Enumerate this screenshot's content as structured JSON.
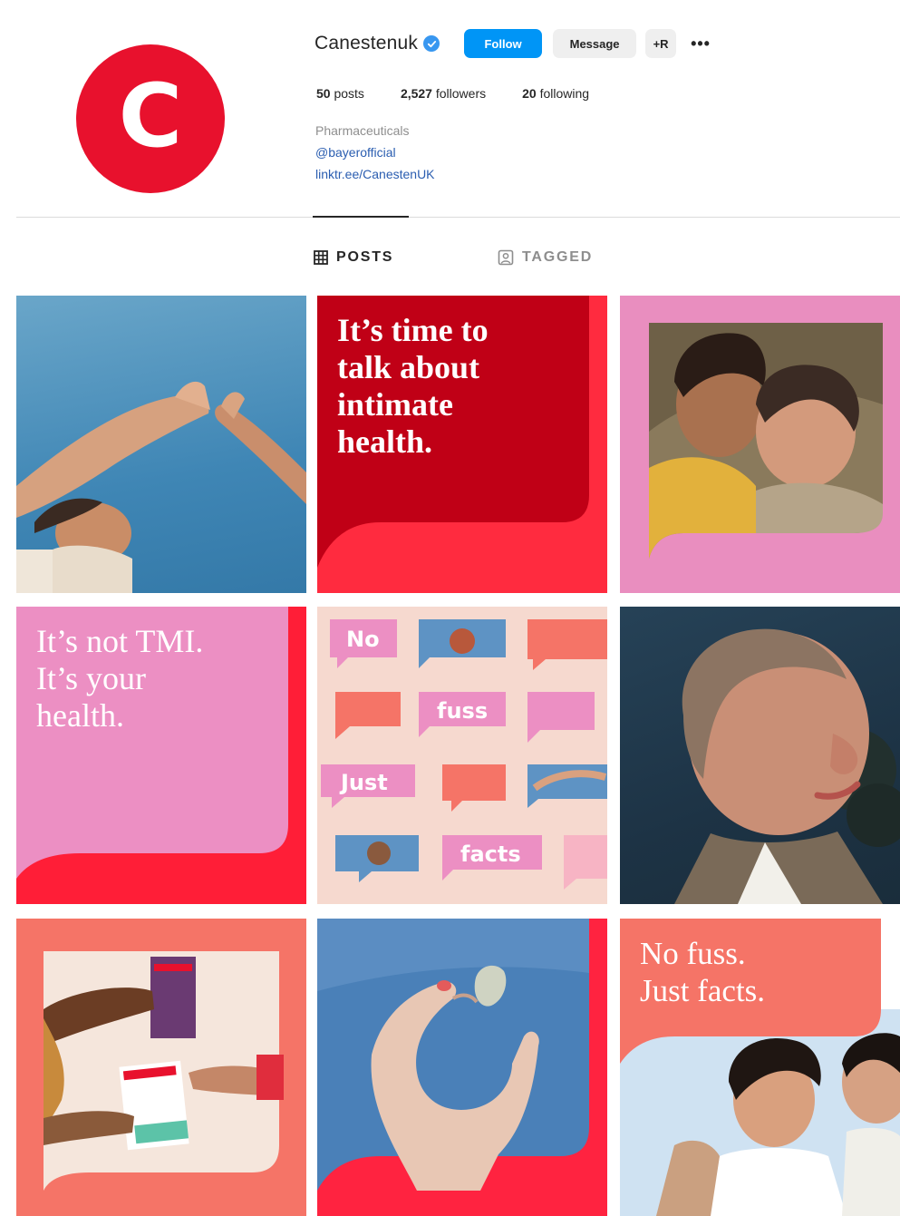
{
  "profile": {
    "avatar_letter": "C",
    "username": "Canestenuk",
    "verified_icon": "verified-badge-icon",
    "follow_label": "Follow",
    "message_label": "Message",
    "suggest_label": "+R",
    "more_label": "•••",
    "stats": {
      "posts_count": "50",
      "posts_label": "posts",
      "followers_count": "2,527",
      "followers_label": "followers",
      "following_count": "20",
      "following_label": "following"
    },
    "bio": {
      "category": "Pharmaceuticals",
      "tag": "@bayerofficial",
      "link": "linktr.ee/CanestenUK"
    }
  },
  "tabs": [
    {
      "label": "POSTS",
      "icon": "grid-icon",
      "active": true
    },
    {
      "label": "TAGGED",
      "icon": "tagged-user-icon",
      "active": false
    }
  ],
  "posts": {
    "t2_lines": [
      "It’s time to",
      "talk about",
      "intimate",
      "health."
    ],
    "t4_lines": [
      "It’s not TMI.",
      "It’s your",
      "health."
    ],
    "t5_words": [
      "No",
      "fuss",
      "Just",
      "facts"
    ],
    "t9_lines": [
      "No fuss.",
      "Just facts."
    ]
  },
  "colors": {
    "brand_red": "#e8112d",
    "follow_blue": "#0095f6",
    "link_blue": "#2a5db0",
    "pink": "#e98ebf",
    "coral": "#f57467"
  }
}
